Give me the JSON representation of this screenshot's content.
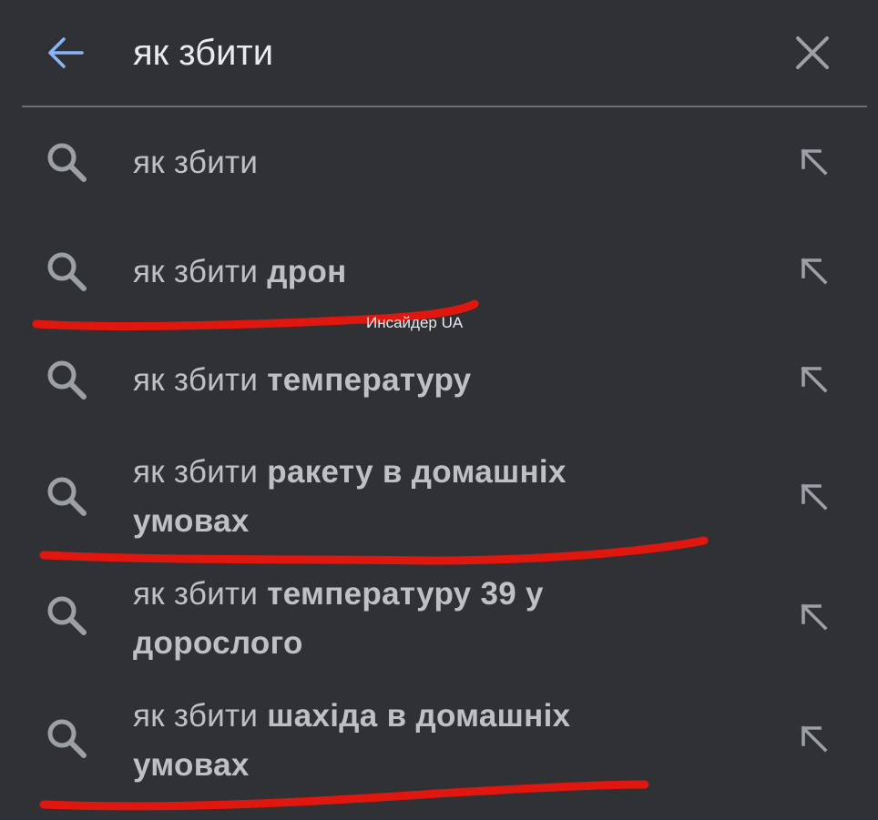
{
  "search": {
    "query": "як збити"
  },
  "suggestions": [
    {
      "prefix": "як збити",
      "suffix": ""
    },
    {
      "prefix": "як збити",
      "suffix": "дрон"
    },
    {
      "prefix": "як збити",
      "suffix": "температуру"
    },
    {
      "prefix": "як збити",
      "suffix": "ракету в домашніх умовах"
    },
    {
      "prefix": "як збити",
      "suffix": "температуру 39 у дорослого"
    },
    {
      "prefix": "як збити",
      "suffix": "шахіда в домашніх умовах"
    }
  ],
  "watermark": "Инсайдер UA",
  "colors": {
    "background": "#303134",
    "accent": "#8ab4f8",
    "text": "#bdc1c6",
    "annotation": "#e0170f"
  },
  "icons": {
    "back": "arrow-back-icon",
    "clear": "close-icon",
    "suggestion": "search-icon",
    "fill": "arrow-up-left-icon"
  }
}
